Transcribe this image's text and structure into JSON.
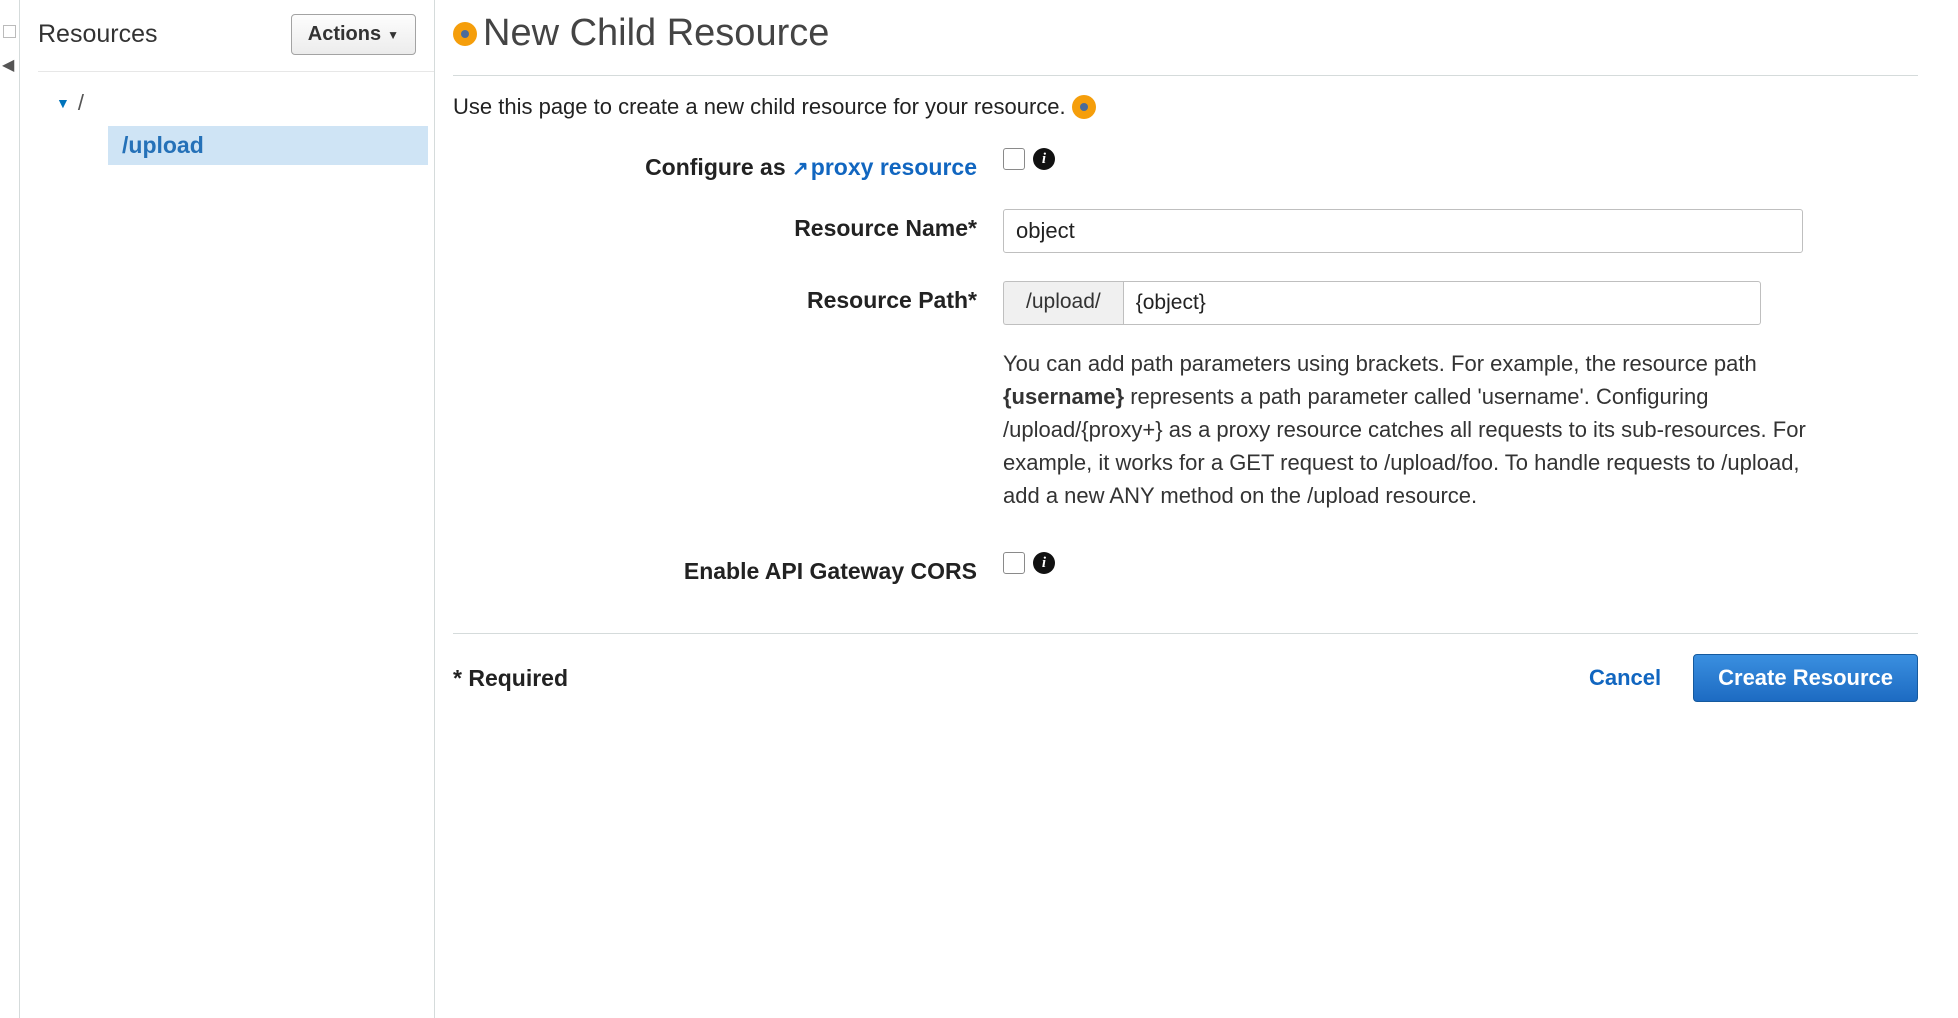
{
  "sidebar": {
    "title": "Resources",
    "actions_label": "Actions",
    "root_label": "/",
    "selected_item": "/upload"
  },
  "page": {
    "title": "New Child Resource",
    "description": "Use this page to create a new child resource for your resource."
  },
  "form": {
    "proxy": {
      "label_prefix": "Configure as ",
      "link_text": "proxy resource",
      "checked": false
    },
    "name": {
      "label": "Resource Name*",
      "value": "object"
    },
    "path": {
      "label": "Resource Path*",
      "prefix": "/upload/",
      "value": "{object}",
      "help_pre": "You can add path parameters using brackets. For example, the resource path ",
      "help_bold": "{username}",
      "help_post": " represents a path parameter called 'username'. Configuring /upload/{proxy+} as a proxy resource catches all requests to its sub-resources. For example, it works for a GET request to /upload/foo. To handle requests to /upload, add a new ANY method on the /upload resource."
    },
    "cors": {
      "label": "Enable API Gateway CORS",
      "checked": false
    }
  },
  "footer": {
    "required_note": "* Required",
    "cancel": "Cancel",
    "create": "Create Resource"
  }
}
